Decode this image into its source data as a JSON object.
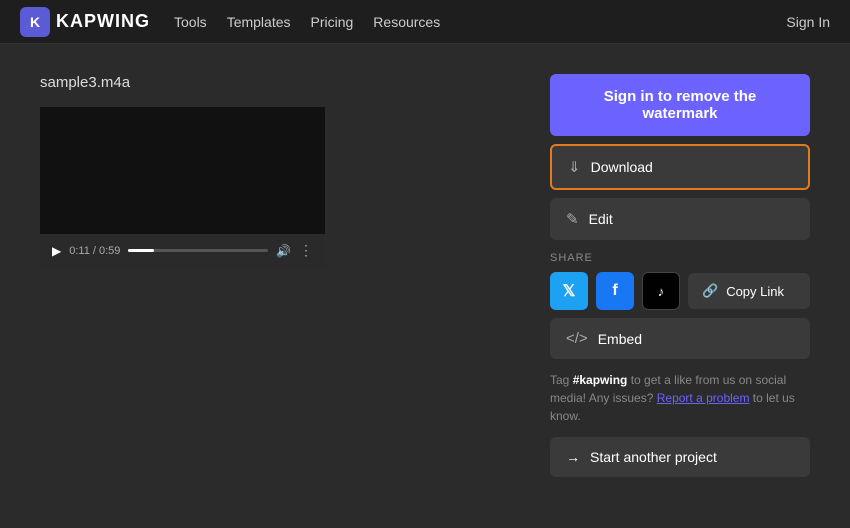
{
  "nav": {
    "logo_text": "KAPWING",
    "links": [
      "Tools",
      "Templates",
      "Pricing",
      "Resources"
    ],
    "signin_label": "Sign In"
  },
  "main": {
    "project_title": "sample3.m4a",
    "player": {
      "time_current": "0:11",
      "time_total": "0:59"
    },
    "right": {
      "watermark_btn": "Sign in to remove the watermark",
      "download_btn": "Download",
      "edit_btn": "Edit",
      "share_label": "SHARE",
      "copylink_btn": "Copy Link",
      "embed_btn": "Embed",
      "tag_text_before": "Tag ",
      "tag_hashtag": "#kapwing",
      "tag_text_after": " to get a like from us on social media! Any issues? ",
      "report_link": "Report a problem",
      "tag_text_end": " to let us know.",
      "new_project_btn": "Start another project"
    }
  }
}
